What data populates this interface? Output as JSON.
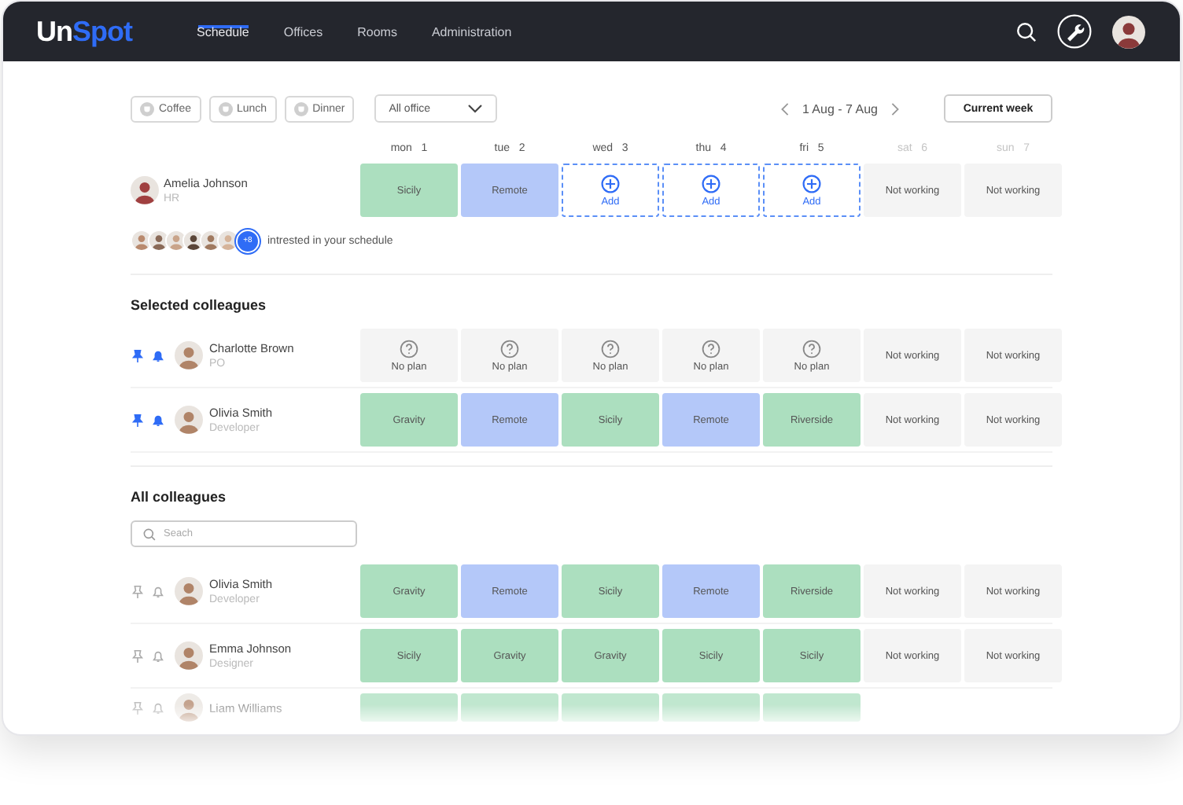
{
  "app": {
    "logo_part_1": "Un",
    "logo_part_2": "Spot"
  },
  "nav": [
    {
      "label": "Schedule",
      "selected": true
    },
    {
      "label": "Offices",
      "selected": false
    },
    {
      "label": "Rooms",
      "selected": false
    },
    {
      "label": "Administration",
      "selected": false
    }
  ],
  "filters": [
    {
      "label": "Coffee"
    },
    {
      "label": "Lunch"
    },
    {
      "label": "Dinner"
    }
  ],
  "office_select": {
    "value": "All office"
  },
  "week": {
    "range": "1 Aug - 7 Aug",
    "button": "Current week"
  },
  "days": [
    {
      "name": "mon",
      "number": "1",
      "weekend": false
    },
    {
      "name": "tue",
      "number": "2",
      "weekend": false
    },
    {
      "name": "wed",
      "number": "3",
      "weekend": false
    },
    {
      "name": "thu",
      "number": "4",
      "weekend": false
    },
    {
      "name": "fri",
      "number": "5",
      "weekend": false
    },
    {
      "name": "sat",
      "number": "6",
      "weekend": true
    },
    {
      "name": "sun",
      "number": "7",
      "weekend": true
    }
  ],
  "me": {
    "name": "Amelia Johnson",
    "role": "HR",
    "cells": [
      {
        "kind": "office",
        "label": "Sicily"
      },
      {
        "kind": "remote",
        "label": "Remote"
      },
      {
        "kind": "add",
        "label": "Add"
      },
      {
        "kind": "add",
        "label": "Add"
      },
      {
        "kind": "add",
        "label": "Add"
      },
      {
        "kind": "off",
        "label": "Not working"
      },
      {
        "kind": "off",
        "label": "Not working"
      }
    ]
  },
  "interested": {
    "more": "+8",
    "text": "intrested in your schedule"
  },
  "selected_colleagues": {
    "title": "Selected colleagues",
    "rows": [
      {
        "name": "Charlotte Brown",
        "role": "PO",
        "pinned": true,
        "cells": [
          {
            "kind": "noplan",
            "label": "No plan"
          },
          {
            "kind": "noplan",
            "label": "No plan"
          },
          {
            "kind": "noplan",
            "label": "No plan"
          },
          {
            "kind": "noplan",
            "label": "No plan"
          },
          {
            "kind": "noplan",
            "label": "No plan"
          },
          {
            "kind": "off",
            "label": "Not working"
          },
          {
            "kind": "off",
            "label": "Not working"
          }
        ]
      },
      {
        "name": "Olivia Smith",
        "role": "Developer",
        "pinned": true,
        "cells": [
          {
            "kind": "office",
            "label": "Gravity"
          },
          {
            "kind": "remote",
            "label": "Remote"
          },
          {
            "kind": "office",
            "label": "Sicily"
          },
          {
            "kind": "remote",
            "label": "Remote"
          },
          {
            "kind": "office",
            "label": "Riverside"
          },
          {
            "kind": "off",
            "label": "Not working"
          },
          {
            "kind": "off",
            "label": "Not working"
          }
        ]
      }
    ]
  },
  "all_colleagues": {
    "title": "All colleagues",
    "search_placeholder": "Seach",
    "rows": [
      {
        "name": "Olivia Smith",
        "role": "Developer",
        "pinned": false,
        "faded": false,
        "cells": [
          {
            "kind": "office",
            "label": "Gravity"
          },
          {
            "kind": "remote",
            "label": "Remote"
          },
          {
            "kind": "office",
            "label": "Sicily"
          },
          {
            "kind": "remote",
            "label": "Remote"
          },
          {
            "kind": "office",
            "label": "Riverside"
          },
          {
            "kind": "off",
            "label": "Not working"
          },
          {
            "kind": "off",
            "label": "Not working"
          }
        ]
      },
      {
        "name": "Emma Johnson",
        "role": "Designer",
        "pinned": false,
        "faded": false,
        "cells": [
          {
            "kind": "office",
            "label": "Sicily"
          },
          {
            "kind": "office",
            "label": "Gravity"
          },
          {
            "kind": "office",
            "label": "Gravity"
          },
          {
            "kind": "office",
            "label": "Sicily"
          },
          {
            "kind": "office",
            "label": "Sicily"
          },
          {
            "kind": "off",
            "label": "Not working"
          },
          {
            "kind": "off",
            "label": "Not working"
          }
        ]
      },
      {
        "name": "Liam Williams",
        "pinned": false,
        "faded": true,
        "cells": [
          {
            "kind": "office"
          },
          {
            "kind": "office"
          },
          {
            "kind": "office"
          },
          {
            "kind": "office"
          },
          {
            "kind": "office"
          }
        ]
      }
    ]
  }
}
